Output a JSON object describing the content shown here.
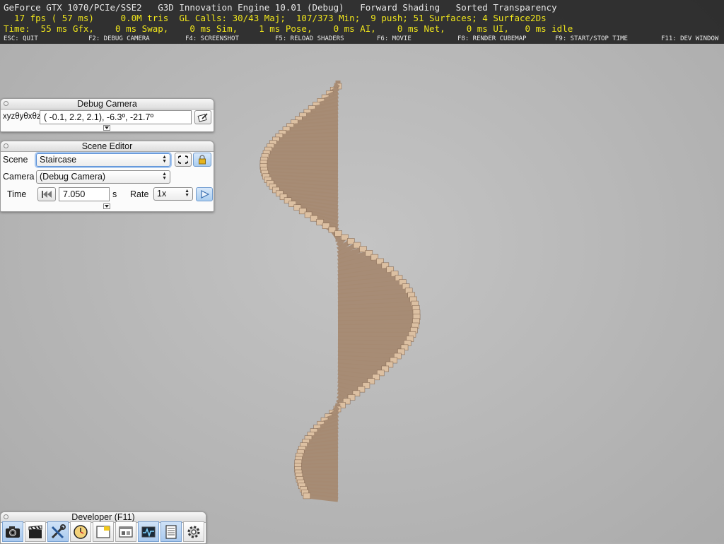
{
  "hud": {
    "line1": "GeForce GTX 1070/PCIe/SSE2   G3D Innovation Engine 10.01 (Debug)   Forward Shading   Sorted Transparency",
    "line2": "  17 fps ( 57 ms)     0.0M tris  GL Calls: 30/43 Maj;  107/373 Min;  9 push; 51 Surfaces; 4 Surface2Ds",
    "line3": "Time:  55 ms Gfx,    0 ms Swap,    0 ms Sim,    1 ms Pose,    0 ms AI,    0 ms Net,    0 ms UI,   0 ms idle",
    "keys": [
      "ESC: QUIT",
      "F2: DEBUG CAMERA",
      "F4: SCREENSHOT",
      "F5: RELOAD SHADERS",
      "F6: MOVIE",
      "F8: RENDER CUBEMAP",
      "F9: START/STOP TIME",
      "F11: DEV WINDOW"
    ]
  },
  "debug_camera": {
    "title": "Debug Camera",
    "label": "xyzθyθxθz",
    "value": "( -0.1,    2.2,    2.1),  -6.3º, -21.7º",
    "copy_icon": "clipboard-pencil-icon"
  },
  "scene_editor": {
    "title": "Scene Editor",
    "scene_label": "Scene",
    "scene_value": "Staircase",
    "camera_label": "Camera",
    "camera_value": "(Debug Camera)",
    "time_label": "Time",
    "time_value": "7.050",
    "time_unit": "s",
    "rate_label": "Rate",
    "rate_value": "1x",
    "reload_icon": "reload-icon",
    "lock_icon": "lock-icon",
    "play_icon": "play-icon",
    "rewind_icon": "rewind-icon"
  },
  "developer": {
    "title": "Developer (F11)",
    "tools": [
      "camera-icon",
      "clapperboard-icon",
      "wrench-screwdriver-icon",
      "clock-icon",
      "note-window-icon",
      "scene-window-icon",
      "profiler-icon",
      "log-icon",
      "gear-icon"
    ]
  },
  "colors": {
    "hud_yellow": "#f0e61c",
    "plank": "#a68a72",
    "plank_end": "#dcc0a2",
    "accent_blue": "#aacdef"
  }
}
